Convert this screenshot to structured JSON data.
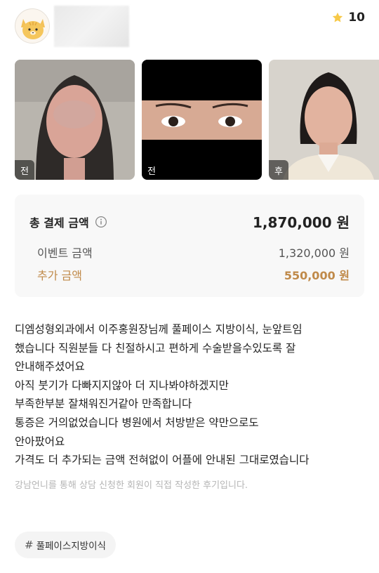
{
  "header": {
    "avatar_icon": "cat-face-icon",
    "rating_icon": "star-icon",
    "rating": "10",
    "star_color": "#f7c948"
  },
  "photos": [
    {
      "tag": "전"
    },
    {
      "tag": "전"
    },
    {
      "tag": "후"
    }
  ],
  "price": {
    "total_label": "총 결제 금액",
    "info_icon": "info-circle-icon",
    "total_value": "1,870,000 원",
    "event_label": "이벤트 금액",
    "event_value": "1,320,000 원",
    "extra_label": "추가 금액",
    "extra_value": "550,000 원",
    "extra_color": "#c08a4a"
  },
  "review": {
    "lines": [
      "디엠성형외과에서 이주홍원장님께 풀페이스 지방이식, 눈앞트임",
      "했습니다 직원분들 다 친절하시고 편하게 수술받을수있도록 잘",
      "안내해주셨어요",
      "아직 붓기가 다빠지지않아 더 지나봐야하겠지만",
      "부족한부분 잘채워진거같아 만족합니다",
      "통증은 거의없었습니다 병원에서 처방받은 약만으로도",
      "안아팠어요",
      "가격도 더 추가되는 금액 전혀없이 어플에 안내된 그대로였습니다"
    ],
    "disclaimer": "강남언니를 통해 상담 신청한 회원이 직접 작성한 후기입니다."
  },
  "hashtag": {
    "symbol": "#",
    "label": "풀페이스지방이식"
  }
}
